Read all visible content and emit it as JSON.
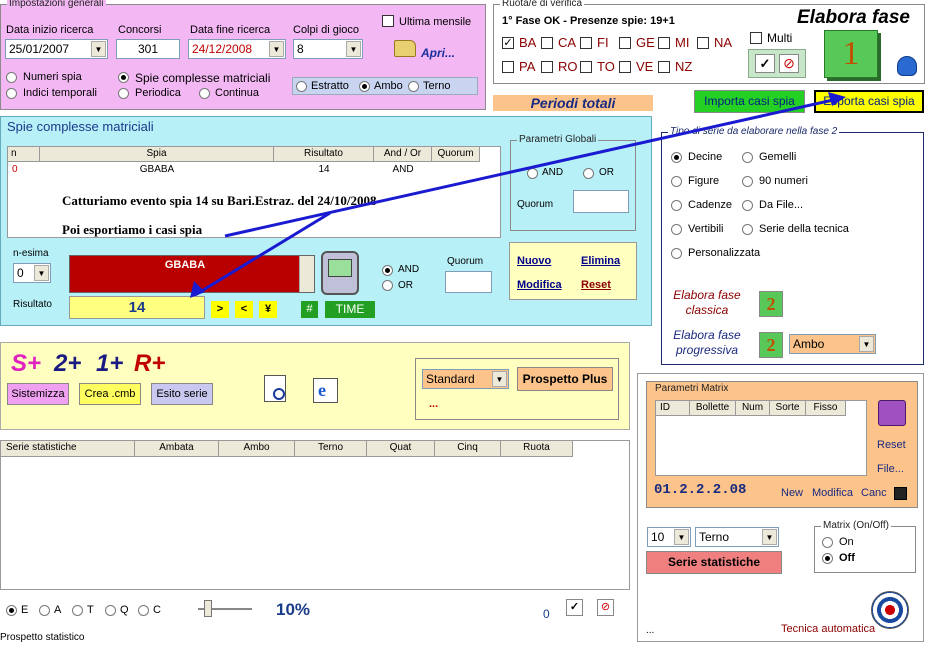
{
  "general": {
    "legend": "Impostazioni generali",
    "start_label": "Data inizio ricerca",
    "start_value": "25/01/2007",
    "contests_label": "Concorsi",
    "contests_value": "301",
    "end_label": "Data fine ricerca",
    "end_value": "24/12/2008",
    "shots_label": "Colpi di gioco",
    "shots_value": "8",
    "monthly_label": "Ultima mensile",
    "open_label": "Apri...",
    "spy_numbers": "Numeri spia",
    "complex": "Spie complesse matriciali",
    "temporal": "Indici temporali",
    "periodic": "Periodica",
    "continuous": "Continua",
    "estratto": "Estratto",
    "ambo": "Ambo",
    "terno": "Terno"
  },
  "wheels": {
    "legend": "Ruota/e di verifica",
    "status": "1° Fase OK - Presenze spie: 19+1",
    "row1": [
      "BA",
      "CA",
      "FI",
      "GE",
      "MI",
      "NA"
    ],
    "row2": [
      "PA",
      "RO",
      "TO",
      "VE",
      "NZ"
    ],
    "multi": "Multi",
    "check": "✓",
    "cancel": "⊘"
  },
  "phase": {
    "title": "Elabora fase",
    "number": "1"
  },
  "periods": "Periodi totali",
  "buttons": {
    "import": "Importa casi spia",
    "export": "Esporta casi spia"
  },
  "complex": {
    "legend": "Spie complesse matriciali",
    "cols": [
      "n",
      "Spia",
      "Risultato",
      "And / Or",
      "Quorum"
    ],
    "row": {
      "n": "0",
      "spia": "GBABA",
      "res": "14",
      "andor": "AND",
      "quorum": ""
    },
    "note1": "Catturiamo evento spia 14 su Bari.Estraz. del 24/10/2008",
    "note2": "Poi esportiamo i casi spia",
    "nesima_label": "n-esima",
    "nesima_value": "0",
    "display": "GBABA",
    "result_label": "Risultato",
    "result_value": "14",
    "op_gt": ">",
    "op_lt": "<",
    "op_yen": "¥",
    "hash": "#",
    "time": "TIME",
    "and": "AND",
    "or": "OR",
    "quorum_label": "Quorum"
  },
  "global": {
    "legend": "Parametri Globali",
    "and": "AND",
    "or": "OR",
    "quorum": "Quorum"
  },
  "actions": {
    "new": "Nuovo",
    "delete": "Elimina",
    "edit": "Modifica",
    "reset": "Reset"
  },
  "series": {
    "legend": "Tipo di serie da elaborare nella fase 2",
    "options": [
      "Decine",
      "Gemelli",
      "Figure",
      "90 numeri",
      "Cadenze",
      "Da File...",
      "Vertibili",
      "Serie della tecnica",
      "Personalizzata"
    ],
    "classic": "Elabora fase classica",
    "progressive": "Elabora fase progressiva",
    "two": "2",
    "prog_select": "Ambo"
  },
  "splus": {
    "s": "S+",
    "two": "2+",
    "one": "1+",
    "r": "R+",
    "sistemizza": "Sistemizza",
    "crea": "Crea .cmb",
    "esito": "Esito serie",
    "standard": "Standard",
    "prospetto": "Prospetto Plus",
    "dots": "..."
  },
  "stats_table": {
    "cols": [
      "Serie statistiche",
      "Ambata",
      "Ambo",
      "Terno",
      "Quat",
      "Cinq",
      "Ruota"
    ]
  },
  "matrix": {
    "legend": "Parametri Matrix",
    "cols": [
      "ID",
      "Bollette",
      "Num",
      "Sorte",
      "Fisso"
    ],
    "code": "01.2.2.2.08",
    "new": "New",
    "edit": "Modifica",
    "canc": "Canc",
    "reset": "Reset",
    "file": "File...",
    "count": "10",
    "sorte": "Terno",
    "stat_btn": "Serie statistiche",
    "onoff_legend": "Matrix (On/Off)",
    "on": "On",
    "off": "Off",
    "dots": "...",
    "auto": "Tecnica automatica"
  },
  "bottom": {
    "radios": [
      "E",
      "A",
      "T",
      "Q",
      "C"
    ],
    "percent": "10%",
    "zero": "0",
    "status": "Prospetto statistico"
  }
}
